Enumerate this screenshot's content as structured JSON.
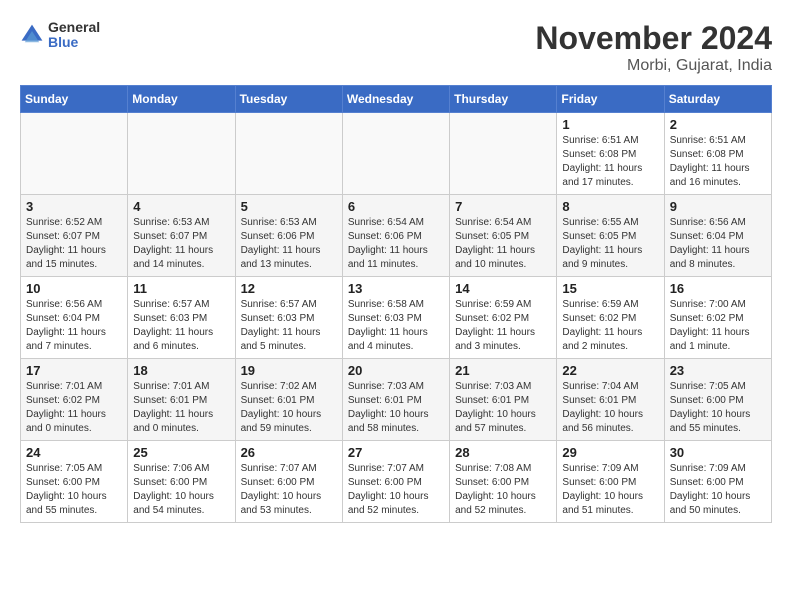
{
  "logo": {
    "general": "General",
    "blue": "Blue"
  },
  "title": "November 2024",
  "location": "Morbi, Gujarat, India",
  "weekdays": [
    "Sunday",
    "Monday",
    "Tuesday",
    "Wednesday",
    "Thursday",
    "Friday",
    "Saturday"
  ],
  "weeks": [
    [
      {
        "day": "",
        "info": ""
      },
      {
        "day": "",
        "info": ""
      },
      {
        "day": "",
        "info": ""
      },
      {
        "day": "",
        "info": ""
      },
      {
        "day": "",
        "info": ""
      },
      {
        "day": "1",
        "info": "Sunrise: 6:51 AM\nSunset: 6:08 PM\nDaylight: 11 hours\nand 17 minutes."
      },
      {
        "day": "2",
        "info": "Sunrise: 6:51 AM\nSunset: 6:08 PM\nDaylight: 11 hours\nand 16 minutes."
      }
    ],
    [
      {
        "day": "3",
        "info": "Sunrise: 6:52 AM\nSunset: 6:07 PM\nDaylight: 11 hours\nand 15 minutes."
      },
      {
        "day": "4",
        "info": "Sunrise: 6:53 AM\nSunset: 6:07 PM\nDaylight: 11 hours\nand 14 minutes."
      },
      {
        "day": "5",
        "info": "Sunrise: 6:53 AM\nSunset: 6:06 PM\nDaylight: 11 hours\nand 13 minutes."
      },
      {
        "day": "6",
        "info": "Sunrise: 6:54 AM\nSunset: 6:06 PM\nDaylight: 11 hours\nand 11 minutes."
      },
      {
        "day": "7",
        "info": "Sunrise: 6:54 AM\nSunset: 6:05 PM\nDaylight: 11 hours\nand 10 minutes."
      },
      {
        "day": "8",
        "info": "Sunrise: 6:55 AM\nSunset: 6:05 PM\nDaylight: 11 hours\nand 9 minutes."
      },
      {
        "day": "9",
        "info": "Sunrise: 6:56 AM\nSunset: 6:04 PM\nDaylight: 11 hours\nand 8 minutes."
      }
    ],
    [
      {
        "day": "10",
        "info": "Sunrise: 6:56 AM\nSunset: 6:04 PM\nDaylight: 11 hours\nand 7 minutes."
      },
      {
        "day": "11",
        "info": "Sunrise: 6:57 AM\nSunset: 6:03 PM\nDaylight: 11 hours\nand 6 minutes."
      },
      {
        "day": "12",
        "info": "Sunrise: 6:57 AM\nSunset: 6:03 PM\nDaylight: 11 hours\nand 5 minutes."
      },
      {
        "day": "13",
        "info": "Sunrise: 6:58 AM\nSunset: 6:03 PM\nDaylight: 11 hours\nand 4 minutes."
      },
      {
        "day": "14",
        "info": "Sunrise: 6:59 AM\nSunset: 6:02 PM\nDaylight: 11 hours\nand 3 minutes."
      },
      {
        "day": "15",
        "info": "Sunrise: 6:59 AM\nSunset: 6:02 PM\nDaylight: 11 hours\nand 2 minutes."
      },
      {
        "day": "16",
        "info": "Sunrise: 7:00 AM\nSunset: 6:02 PM\nDaylight: 11 hours\nand 1 minute."
      }
    ],
    [
      {
        "day": "17",
        "info": "Sunrise: 7:01 AM\nSunset: 6:02 PM\nDaylight: 11 hours\nand 0 minutes."
      },
      {
        "day": "18",
        "info": "Sunrise: 7:01 AM\nSunset: 6:01 PM\nDaylight: 11 hours\nand 0 minutes."
      },
      {
        "day": "19",
        "info": "Sunrise: 7:02 AM\nSunset: 6:01 PM\nDaylight: 10 hours\nand 59 minutes."
      },
      {
        "day": "20",
        "info": "Sunrise: 7:03 AM\nSunset: 6:01 PM\nDaylight: 10 hours\nand 58 minutes."
      },
      {
        "day": "21",
        "info": "Sunrise: 7:03 AM\nSunset: 6:01 PM\nDaylight: 10 hours\nand 57 minutes."
      },
      {
        "day": "22",
        "info": "Sunrise: 7:04 AM\nSunset: 6:01 PM\nDaylight: 10 hours\nand 56 minutes."
      },
      {
        "day": "23",
        "info": "Sunrise: 7:05 AM\nSunset: 6:00 PM\nDaylight: 10 hours\nand 55 minutes."
      }
    ],
    [
      {
        "day": "24",
        "info": "Sunrise: 7:05 AM\nSunset: 6:00 PM\nDaylight: 10 hours\nand 55 minutes."
      },
      {
        "day": "25",
        "info": "Sunrise: 7:06 AM\nSunset: 6:00 PM\nDaylight: 10 hours\nand 54 minutes."
      },
      {
        "day": "26",
        "info": "Sunrise: 7:07 AM\nSunset: 6:00 PM\nDaylight: 10 hours\nand 53 minutes."
      },
      {
        "day": "27",
        "info": "Sunrise: 7:07 AM\nSunset: 6:00 PM\nDaylight: 10 hours\nand 52 minutes."
      },
      {
        "day": "28",
        "info": "Sunrise: 7:08 AM\nSunset: 6:00 PM\nDaylight: 10 hours\nand 52 minutes."
      },
      {
        "day": "29",
        "info": "Sunrise: 7:09 AM\nSunset: 6:00 PM\nDaylight: 10 hours\nand 51 minutes."
      },
      {
        "day": "30",
        "info": "Sunrise: 7:09 AM\nSunset: 6:00 PM\nDaylight: 10 hours\nand 50 minutes."
      }
    ]
  ]
}
